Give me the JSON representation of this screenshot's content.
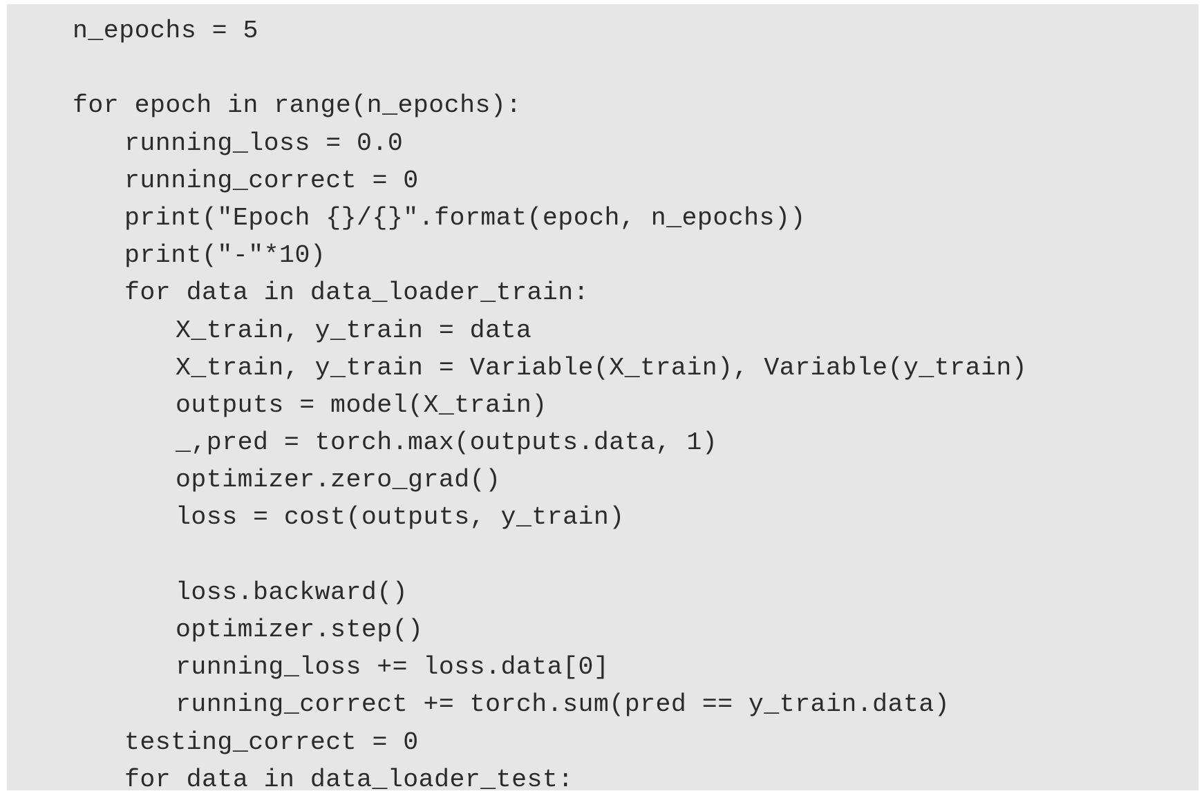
{
  "code": {
    "lines": [
      {
        "indent": 0,
        "text": "n_epochs = 5"
      },
      {
        "indent": 0,
        "text": ""
      },
      {
        "indent": 0,
        "text": "for epoch in range(n_epochs):"
      },
      {
        "indent": 1,
        "text": "running_loss = 0.0"
      },
      {
        "indent": 1,
        "text": "running_correct = 0"
      },
      {
        "indent": 1,
        "text": "print(\"Epoch {}/{}\".format(epoch, n_epochs))"
      },
      {
        "indent": 1,
        "text": "print(\"-\"*10)"
      },
      {
        "indent": 1,
        "text": "for data in data_loader_train:"
      },
      {
        "indent": 2,
        "text": "X_train, y_train = data"
      },
      {
        "indent": 2,
        "text": "X_train, y_train = Variable(X_train), Variable(y_train)"
      },
      {
        "indent": 2,
        "text": "outputs = model(X_train)"
      },
      {
        "indent": 2,
        "text": "_,pred = torch.max(outputs.data, 1)"
      },
      {
        "indent": 2,
        "text": "optimizer.zero_grad()"
      },
      {
        "indent": 2,
        "text": "loss = cost(outputs, y_train)"
      },
      {
        "indent": 2,
        "text": ""
      },
      {
        "indent": 2,
        "text": "loss.backward()"
      },
      {
        "indent": 2,
        "text": "optimizer.step()"
      },
      {
        "indent": 2,
        "text": "running_loss += loss.data[0]"
      },
      {
        "indent": 2,
        "text": "running_correct += torch.sum(pred == y_train.data)"
      },
      {
        "indent": 1,
        "text": "testing_correct = 0"
      },
      {
        "indent": 1,
        "text": "for data in data_loader_test:"
      }
    ]
  }
}
